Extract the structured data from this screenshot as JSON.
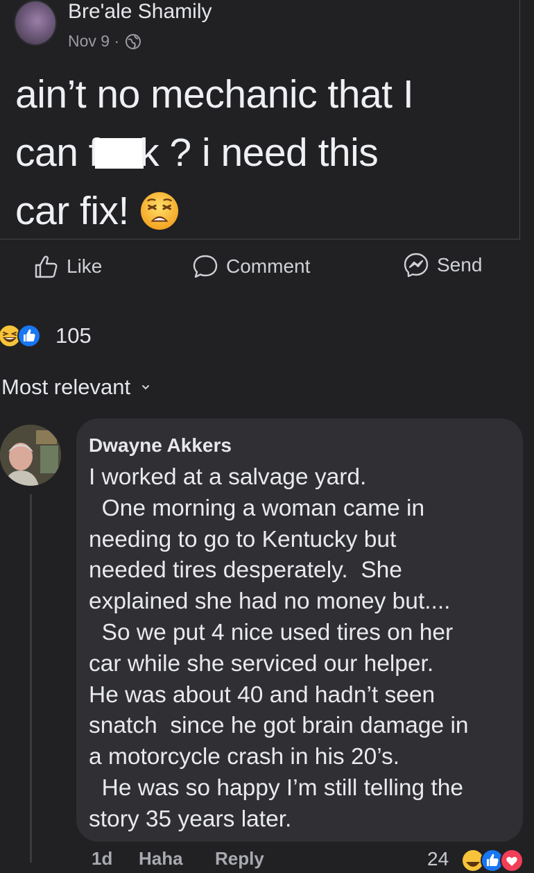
{
  "post": {
    "author": "Bre'ale Shamily",
    "date": "Nov 9 ·",
    "privacy_icon": "globe-icon",
    "line1": "ain’t no mechanic that I",
    "line2_before": "can f",
    "line2_after": "k ? i need this",
    "line3": "car fix!",
    "emoji": "weary-face-emoji"
  },
  "actions": {
    "like_label": "Like",
    "comment_label": "Comment",
    "send_label": "Send"
  },
  "reactions": {
    "icons": [
      "haha-icon",
      "like-icon"
    ],
    "count": "105"
  },
  "sort": {
    "label": "Most relevant"
  },
  "comment": {
    "author": "Dwayne Akkers",
    "text": "I worked at a salvage yard.\n  One morning a woman came in\nneeding to go to Kentucky but\nneeded tires desperately.  She\nexplained she had no money but....\n  So we put 4 nice used tires on her\ncar while she serviced our helper.\nHe was about 40 and hadn’t seen\nsnatch  since he got brain damage in\na motorcycle crash in his 20’s.\n  He was so happy I’m still telling the\nstory 35 years later.",
    "footer": {
      "time": "1d",
      "haha_label": "Haha",
      "reply_label": "Reply",
      "reaction_count": "24",
      "reaction_icons": [
        "haha-icon",
        "like-icon",
        "love-icon"
      ]
    }
  },
  "colors": {
    "background": "#212124",
    "bubble": "#303034",
    "like_blue": "#1877f2",
    "haha_yellow": "#f7c33a",
    "love_red": "#f33e58"
  }
}
